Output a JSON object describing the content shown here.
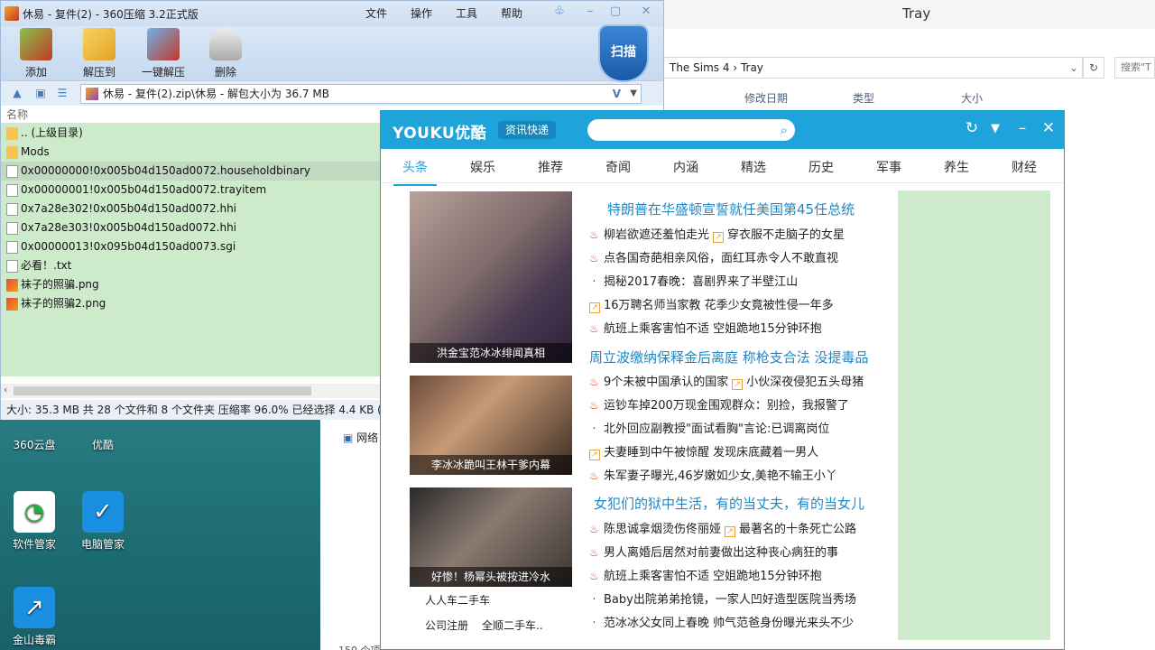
{
  "explorer": {
    "window_title": "Tray",
    "address": [
      "The Sims 4",
      "Tray"
    ],
    "search_placeholder": "搜索\"T",
    "columns": [
      "修改日期",
      "类型",
      "大小"
    ],
    "nav_network": "网络",
    "item_count": "150 个项"
  },
  "desktop": {
    "icons": [
      {
        "label": "360云盘"
      },
      {
        "label": "优酷"
      },
      {
        "label": "软件管家"
      },
      {
        "label": "电脑管家"
      },
      {
        "label": "金山毒霸"
      }
    ]
  },
  "zip": {
    "title": "休易 - 复件(2) - 360压缩 3.2正式版",
    "menu": [
      "文件",
      "操作",
      "工具",
      "帮助"
    ],
    "toolbar": [
      "添加",
      "解压到",
      "一键解压",
      "删除"
    ],
    "scan_label": "扫描",
    "path": "休易 - 复件(2).zip\\休易 - 解包大小为 36.7 MB",
    "column_name": "名称",
    "files": [
      {
        "name": ".. (上级目录)",
        "type": "folder"
      },
      {
        "name": "Mods",
        "type": "folder"
      },
      {
        "name": "0x00000000!0x005b04d150ad0072.householdbinary",
        "type": "file"
      },
      {
        "name": "0x00000001!0x005b04d150ad0072.trayitem",
        "type": "file"
      },
      {
        "name": "0x7a28e302!0x005b04d150ad0072.hhi",
        "type": "file"
      },
      {
        "name": "0x7a28e303!0x005b04d150ad0072.hhi",
        "type": "file"
      },
      {
        "name": "0x00000013!0x095b04d150ad0073.sgi",
        "type": "file"
      },
      {
        "name": "必看！.txt",
        "type": "file"
      },
      {
        "name": "袜子的照骗.png",
        "type": "img"
      },
      {
        "name": "袜子的照骗2.png",
        "type": "img"
      }
    ],
    "status": "大小: 35.3 MB 共 28 个文件和 8 个文件夹 压缩率 96.0% 已经选择 4.4 KB (1"
  },
  "youku": {
    "logo": "YOUKU优酷",
    "tag": "资讯快递",
    "tabs": [
      "头条",
      "娱乐",
      "推荐",
      "奇闻",
      "内涵",
      "精选",
      "历史",
      "军事",
      "养生",
      "财经"
    ],
    "thumbs": [
      {
        "caption": "洪金宝范冰冰绯闻真相"
      },
      {
        "caption": "李冰冰跪叫王林干爹内幕"
      },
      {
        "caption": "好惨！杨幂头被按进冷水"
      }
    ],
    "headlines": [
      "特朗普在华盛顿宣誓就任美国第45任总统",
      "周立波缴纳保释金后离庭 称枪支合法 没提毒品",
      "女犯们的狱中生活，有的当丈夫，有的当女儿"
    ],
    "news_groups": [
      [
        {
          "icon": "hot",
          "text": "柳岩欲遮还羞怕走光",
          "trend_text": "穿衣服不走脑子的女星"
        },
        {
          "icon": "hot",
          "text": "点各国奇葩相亲风俗，面红耳赤令人不敢直视"
        },
        {
          "icon": "dot",
          "text": "揭秘2017春晚：喜剧界来了半壁江山"
        },
        {
          "icon": "trend",
          "text": "16万聘名师当家教 花季少女竟被性侵一年多"
        },
        {
          "icon": "hot",
          "text": "航班上乘客害怕不适 空姐跪地15分钟环抱"
        }
      ],
      [
        {
          "icon": "hot",
          "text": "9个未被中国承认的国家",
          "trend_text": "小伙深夜侵犯五头母猪"
        },
        {
          "icon": "hot",
          "text": "运钞车掉200万现金围观群众：别捡，我报警了"
        },
        {
          "icon": "dot",
          "text": "北外回应副教授\"面试看胸\"言论:已调离岗位"
        },
        {
          "icon": "trend",
          "text": "夫妻睡到中午被惊醒 发现床底藏着一男人"
        },
        {
          "icon": "hot",
          "text": "朱军妻子曝光,46岁嫩如少女,美艳不输王小丫"
        }
      ],
      [
        {
          "icon": "hot",
          "text": "陈思诚拿烟烫伤佟丽娅",
          "trend_text": "最著名的十条死亡公路"
        },
        {
          "icon": "hot",
          "text": "男人离婚后居然对前妻做出这种丧心病狂的事"
        },
        {
          "icon": "hot",
          "text": "航班上乘客害怕不适 空姐跪地15分钟环抱"
        },
        {
          "icon": "dot",
          "text": "Baby出院弟弟抢镜，一家人凹好造型医院当秀场"
        },
        {
          "icon": "dot",
          "text": "范冰冰父女同上春晚 帅气范爸身份曝光来头不少"
        }
      ]
    ],
    "bottom_links": [
      "人人车二手车",
      "公司注册",
      "全顺二手车.."
    ]
  }
}
